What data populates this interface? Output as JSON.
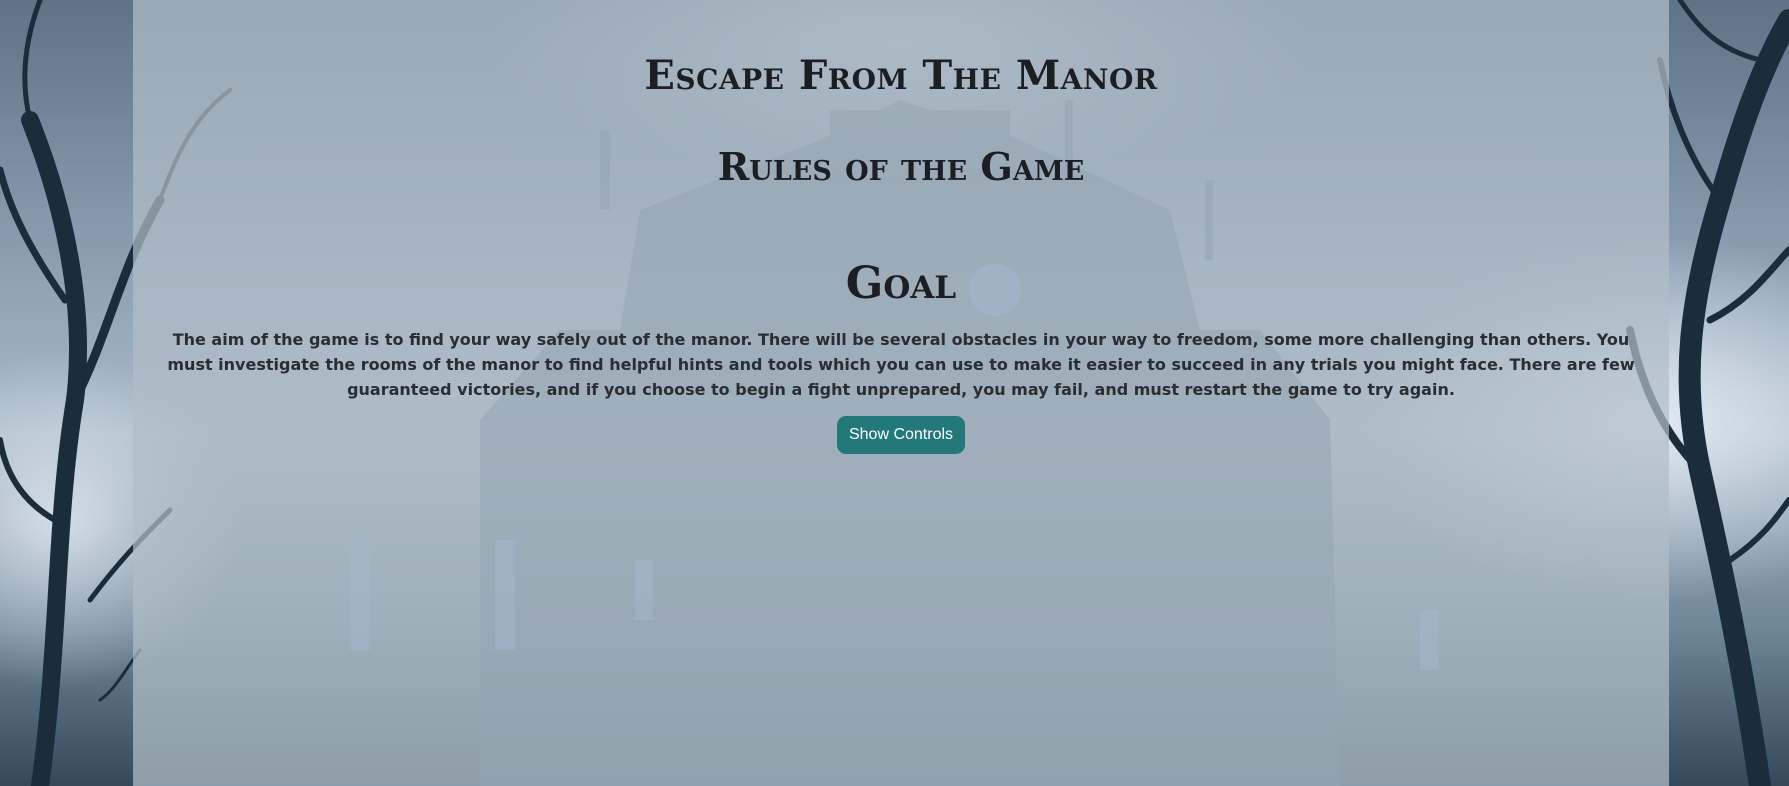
{
  "page": {
    "title": "Escape From The Manor",
    "subtitle": "Rules of the Game"
  },
  "goal": {
    "heading": "Goal",
    "text": "The aim of the game is to find your way safely out of the manor. There will be several obstacles in your way to freedom, some more challenging than others. You must investigate the rooms of the manor to find helpful hints and tools which you can use to make it easier to succeed in any trials you might face. There are few guaranteed victories, and if you choose to begin a fight unprepared, you may fail, and must restart the game to try again."
  },
  "controls": {
    "show_label": "Show Controls"
  },
  "colors": {
    "accent": "#23797a",
    "text": "#1b1f24",
    "panel": "#b0bec8"
  }
}
